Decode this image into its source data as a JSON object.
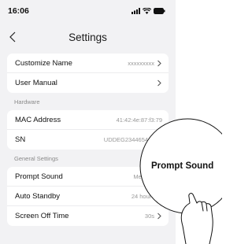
{
  "status_bar": {
    "time": "16:06"
  },
  "nav": {
    "title": "Settings"
  },
  "top_items": [
    {
      "label": "Customize Name",
      "value": "xxxxxxxxx"
    },
    {
      "label": "User Manual",
      "value": ""
    }
  ],
  "hardware": {
    "header": "Hardware",
    "items": [
      {
        "label": "MAC Address",
        "value": "41:42:4e:87:f3:79"
      },
      {
        "label": "SN",
        "value": "UDDEG2344654656N"
      }
    ]
  },
  "general": {
    "header": "General Settings",
    "items": [
      {
        "label": "Prompt Sound",
        "value": "Medium"
      },
      {
        "label": "Auto Standby",
        "value": "24 hours"
      },
      {
        "label": "Screen Off Time",
        "value": "30s"
      }
    ]
  },
  "callout": {
    "label": "Prompt Sound"
  },
  "colors": {
    "background": "#f2f2f4",
    "card": "#ffffff",
    "secondary_text": "#999999"
  }
}
